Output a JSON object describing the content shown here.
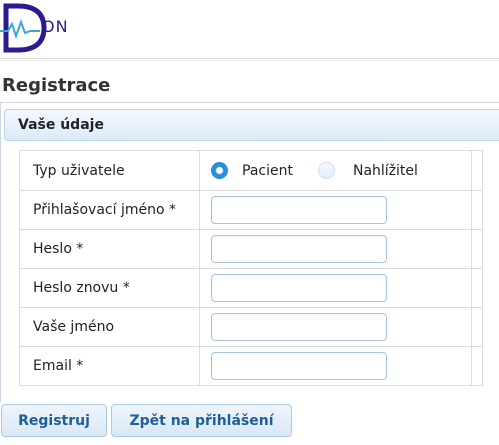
{
  "header": {
    "logo_letter": "D",
    "logo_text": "ON"
  },
  "page": {
    "title": "Registrace"
  },
  "panel": {
    "title": "Vaše údaje"
  },
  "form": {
    "user_type": {
      "label": "Typ uživatele",
      "options": [
        {
          "label": "Pacient",
          "checked": true
        },
        {
          "label": "Nahlížitel",
          "checked": false
        }
      ]
    },
    "fields": [
      {
        "label": "Přihlašovací jméno *",
        "value": ""
      },
      {
        "label": "Heslo *",
        "value": ""
      },
      {
        "label": "Heslo znovu *",
        "value": ""
      },
      {
        "label": "Vaše jméno",
        "value": ""
      },
      {
        "label": "Email *",
        "value": ""
      }
    ]
  },
  "buttons": {
    "register": "Registruj",
    "back": "Zpět na přihlášení"
  },
  "colors": {
    "logo": "#2a1b8f",
    "accent": "#2a8ed8",
    "button_text": "#1f5f96"
  }
}
